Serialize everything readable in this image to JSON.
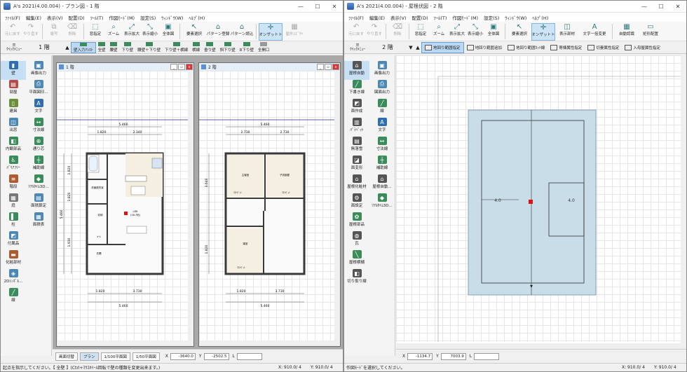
{
  "left": {
    "title": "A's 2021(4.00.004) - プラン図 - 1 階",
    "menus": [
      "ﾌｧｲﾙ(F)",
      "編集(E)",
      "表示(V)",
      "配置(D)",
      "ﾂｰﾙ(T)",
      "作図ﾓｰﾄﾞ(M)",
      "設定(S)",
      "ｳｨﾝﾄﾞｳ(W)",
      "ﾍﾙﾌﾟ(H)"
    ],
    "toolbar": [
      "元に戻す",
      "やり直す",
      "複写",
      "削除",
      "窓指定",
      "ズーム",
      "表示拡大",
      "表示縮小",
      "全体図",
      "要素選択",
      "パターン登録",
      "パターン読込",
      "オンザットト",
      "屋外ｴﾋﾞﾁｬ"
    ],
    "quick_label": "ｸｲｯｸﾒﾆｭｰ",
    "floor": "1 階",
    "wall_tabs": [
      "壁入力ｱｼｽﾄ",
      "全壁",
      "腰壁",
      "下り壁",
      "腰壁＋下り壁",
      "下り壁＋横線",
      "横線",
      "垂り壁",
      "斜下り壁",
      "R下り壁",
      "全開口"
    ],
    "side_col1": [
      "壁",
      "部屋",
      "建具",
      "出窓",
      "内観部品",
      "ﾊﾞﾘｱﾌﾘｰ",
      "階段",
      "庭",
      "柱",
      "付属品",
      "化粧部材",
      "2Dｼﾝﾎﾞﾙ...",
      "線"
    ],
    "side_col2": [
      "画像出力",
      "平面図印...",
      "文字",
      "寸法線",
      "通り芯",
      "補助線",
      "ﾘｱﾙﾀｲﾑ3D...",
      "面積算定",
      "面積表"
    ],
    "child1": {
      "title": "1 階",
      "dims_top_total": "5.460",
      "dims_top": [
        "1.820",
        "2.340"
      ],
      "dims_bottom": [
        "1.820",
        "3.730"
      ],
      "dims_bottom_total": "5.460",
      "dims_left": [
        "1.820",
        "1.820",
        "1.930"
      ],
      "dims_left_total": "5.460",
      "rooms": [
        "洗面脱衣室",
        "LDK",
        "(16.7帖)",
        "収納",
        "玄関",
        "ﾎｰﾙ"
      ]
    },
    "child2": {
      "title": "2 階",
      "dims_top_total": "5.460",
      "dims_top": [
        "2.730",
        "2.730"
      ],
      "dims_bottom": [
        "1.820",
        "3.730"
      ],
      "dims_bottom_total": "5.460",
      "dims_left": [
        "3.640",
        "1.820"
      ],
      "rooms": [
        "主寝室",
        "子供部屋",
        "寝室",
        "ｸﾛｰｾﾞｯﾄ",
        "ｸﾛｰｾﾞｯﾄ",
        "ｸﾛｰｾﾞｯﾄ"
      ]
    },
    "bottom_tabs": [
      "画面切替",
      "プラン",
      "1/100平面図",
      "1/50平面図"
    ],
    "coord_x_label": "X",
    "coord_x": "-3640.0",
    "coord_y_label": "Y",
    "coord_y": "-2502.5",
    "coord_l_label": "L",
    "status_left": "起点を指示してください。【 全壁 】(Ctrl+ﾏｳｽﾎｲｰﾙ回転で壁の種類を変更出来ます。)",
    "status_x": "X: 910.0/ 4",
    "status_y": "Y: 910.0/ 4"
  },
  "right": {
    "title": "A's 2021(4.00.004) - 屋根伏図 - 2 階",
    "menus": [
      "ﾌｧｲﾙ(F)",
      "編集(E)",
      "表示(V)",
      "配置(D)",
      "ﾂｰﾙ(T)",
      "作図ﾓｰﾄﾞ(M)",
      "設定(S)",
      "ｳｨﾝﾄﾞｳ(W)",
      "ﾍﾙﾌﾟ(H)"
    ],
    "toolbar": [
      "元に戻す",
      "やり直す",
      "削除",
      "窓指定",
      "ズーム",
      "表示拡大",
      "表示縮小",
      "全体図",
      "要素選択",
      "オンザットト",
      "表示部材",
      "文字一括変更",
      "自動認識",
      "矩形配置"
    ],
    "quick_label": "ｸｲｯｸﾒﾆｭｰ",
    "floor": "2 階",
    "roof_tabs": [
      "地回り範囲指定",
      "地回り範囲追加",
      "地回り範囲ｶｯﾄ線",
      "寄棟属性指定",
      "切妻属性指定",
      "入母屋属性指定"
    ],
    "side_col1": [
      "屋根自動",
      "下書き線",
      "面作成",
      "ﾊﾟﾗﾍﾟｯﾄ",
      "無落雪",
      "面変形",
      "屋根化粧材",
      "面設定",
      "屋根部品",
      "瓦",
      "屋根横樋",
      "切り取り線"
    ],
    "side_col2": [
      "画像出力",
      "図面出力",
      "線",
      "文字",
      "寸法線",
      "補助線",
      "屋根自動...",
      "ﾘｱﾙﾀｲﾑ3D..."
    ],
    "roof_pitch_left": "4.0",
    "roof_pitch_right": "4.0",
    "coord_x_label": "X",
    "coord_x": "-1134.7",
    "coord_y_label": "Y",
    "coord_y": "7003.9",
    "coord_l_label": "L",
    "status_left": "作図ﾓｰﾄﾞを選択してください。",
    "status_x": "X: 910.0/ 4",
    "status_y": "Y: 910.0/ 4"
  },
  "colors": {
    "accent": "#2c7a7a",
    "wall": "#3a3a3a",
    "roof": "#c8dde8",
    "selected": "#c7dff5",
    "cursor": "#e01010"
  }
}
